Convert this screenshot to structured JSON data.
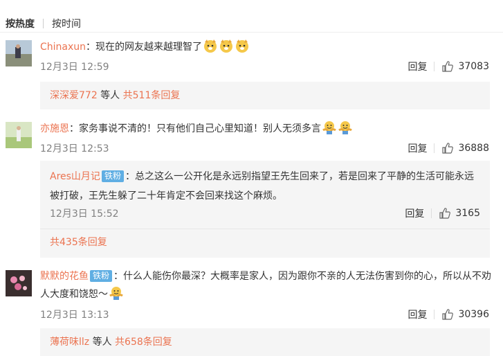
{
  "sort": {
    "hot": "按热度",
    "time": "按时间"
  },
  "comments": [
    {
      "user": "Chinaxun",
      "text": "：现在的网友越来越理智了",
      "time": "12月3日 12:59",
      "reply": "回复",
      "likes": "37083",
      "footer": {
        "who": "深深爱772",
        "mid": " 等人 ",
        "count": "共511条回复"
      }
    },
    {
      "user": "亦施恩",
      "text": "：家务事说不清的！只有他们自己心里知道！别人无须多言",
      "time": "12月3日 12:53",
      "reply": "回复",
      "likes": "36888",
      "sub": {
        "user": "Ares山月记",
        "badge": "铁粉",
        "text": "：总之这么一公开化是永远别指望王先生回来了，若是回来了平静的生活可能永远被打破，王先生躲了二十年肯定不会回来找这个麻烦。",
        "time": "12月3日 15:52",
        "reply": "回复",
        "likes": "3165"
      },
      "footer": {
        "count": "共435条回复"
      }
    },
    {
      "user": "默默的花鱼",
      "badge": "铁粉",
      "text": "：什么人能伤你最深？大概率是家人，因为跟你不亲的人无法伤害到你的心，所以从不劝人大度和饶恕～",
      "time": "12月3日 13:13",
      "reply": "回复",
      "likes": "30396",
      "footer": {
        "who": "薄荷味llz",
        "mid": " 等人 ",
        "count": "共658条回复"
      }
    }
  ],
  "icons": {
    "like": "thumbs-up-icon",
    "emoji_doge": "doge-emoji-icon",
    "emoji_hug": "hug-emoji-icon"
  },
  "colors": {
    "username": "#eb7350",
    "badge": "#5faee3",
    "meta": "#808080"
  }
}
